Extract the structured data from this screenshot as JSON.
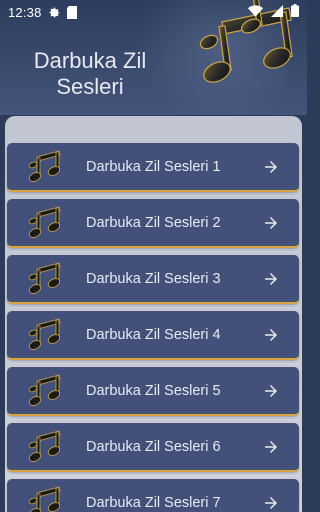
{
  "status_bar": {
    "time": "12:38",
    "icons": [
      "gear-icon",
      "sd-card-icon",
      "wifi-icon",
      "signal-icon",
      "battery-icon"
    ]
  },
  "header": {
    "title": "Darbuka Zil Sesleri",
    "art": "music-notes-icon"
  },
  "colors": {
    "header_bg": "#3a4a6c",
    "panel_bg": "#c8cbd6",
    "item_bg": "#42507a",
    "item_accent": "#d9a441",
    "text": "#e8ebf3"
  },
  "list": {
    "items": [
      {
        "label": "Darbuka Zil Sesleri 1",
        "icon": "music-note-icon",
        "action_icon": "arrow-right-icon"
      },
      {
        "label": "Darbuka Zil Sesleri 2",
        "icon": "music-note-icon",
        "action_icon": "arrow-right-icon"
      },
      {
        "label": "Darbuka Zil Sesleri 3",
        "icon": "music-note-icon",
        "action_icon": "arrow-right-icon"
      },
      {
        "label": "Darbuka Zil Sesleri 4",
        "icon": "music-note-icon",
        "action_icon": "arrow-right-icon"
      },
      {
        "label": "Darbuka Zil Sesleri 5",
        "icon": "music-note-icon",
        "action_icon": "arrow-right-icon"
      },
      {
        "label": "Darbuka Zil Sesleri 6",
        "icon": "music-note-icon",
        "action_icon": "arrow-right-icon"
      },
      {
        "label": "Darbuka Zil Sesleri 7",
        "icon": "music-note-icon",
        "action_icon": "arrow-right-icon"
      }
    ]
  }
}
